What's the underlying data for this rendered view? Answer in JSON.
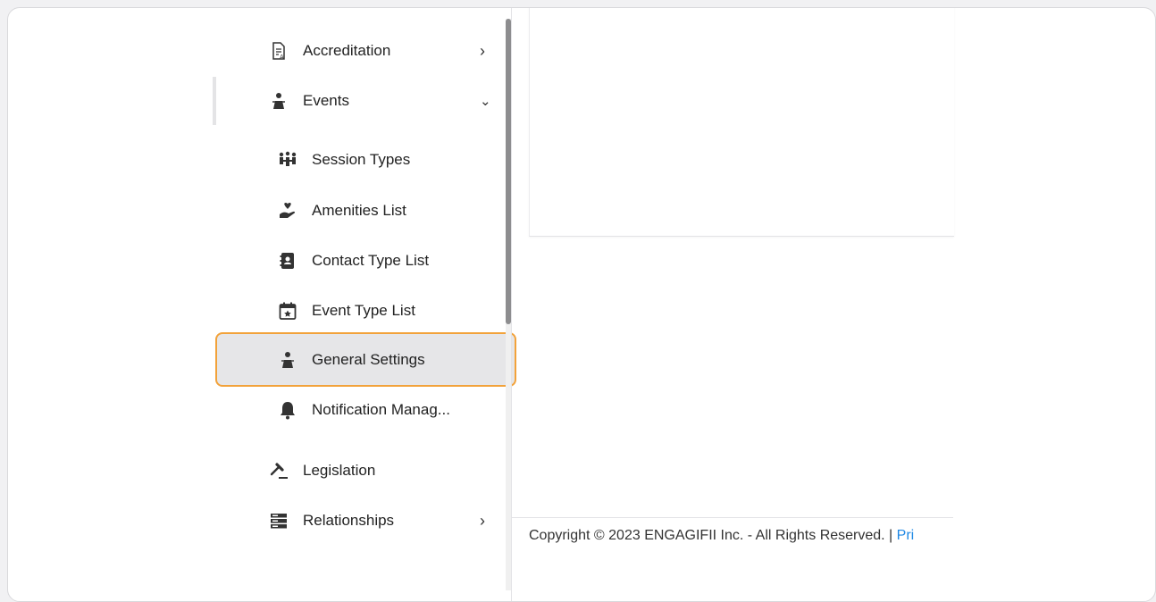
{
  "sidebar": {
    "items": [
      {
        "label": "Accreditation",
        "icon": "accreditation-icon",
        "chevron": "›"
      },
      {
        "label": "Events",
        "icon": "events-icon",
        "chevron": "⌄"
      },
      {
        "label": "Legislation",
        "icon": "gavel-icon"
      },
      {
        "label": "Relationships",
        "icon": "server-icon",
        "chevron": "›"
      }
    ],
    "events_children": [
      {
        "label": "Session Types",
        "icon": "people-group-icon"
      },
      {
        "label": "Amenities List",
        "icon": "hand-heart-icon"
      },
      {
        "label": "Contact Type List",
        "icon": "address-book-icon"
      },
      {
        "label": "Event Type List",
        "icon": "calendar-star-icon"
      },
      {
        "label": "General Settings",
        "icon": "events-icon",
        "selected": true
      },
      {
        "label": "Notification Manag...",
        "icon": "bell-icon"
      }
    ]
  },
  "footer": {
    "copyright": "Copyright © 2023 ENGAGIFII Inc. - All Rights Reserved. | ",
    "link": "Pri"
  },
  "colors": {
    "highlight_border": "#f2a23a",
    "highlight_bg": "#e6e6e8",
    "link": "#1e88e5"
  }
}
